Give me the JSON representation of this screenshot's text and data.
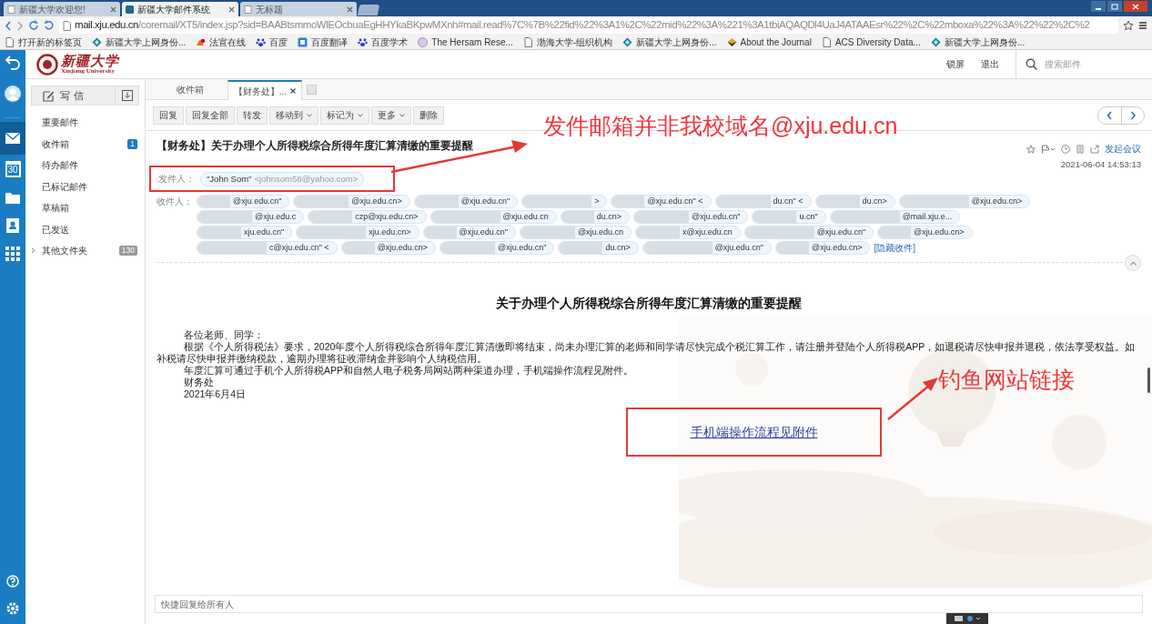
{
  "browser": {
    "tabs": [
      {
        "title": "新疆大学欢迎您!",
        "selected": false
      },
      {
        "title": "新疆大学邮件系统",
        "selected": true
      },
      {
        "title": "无标题",
        "selected": false
      }
    ],
    "url": "**mail.xju.edu.cn**/coremail/XT5/index.jsp?sid=BAABtsmmoWlEOcbuaEgHHYkaBKpwMXnh#mail.read%7C%7B%22fid%22%3A1%2C%22mid%22%3A%221%3A1tbiAQAQDl4UaJ4ATAAEsr%22%2C%22mboxa%22%3A%22%22%2C%2",
    "bookmarks": [
      {
        "label": "打开新的标签页",
        "kind": "page"
      },
      {
        "label": "新疆大学上网身份...",
        "kind": "diamond"
      },
      {
        "label": "法宣在线",
        "kind": "law"
      },
      {
        "label": "百度",
        "kind": "paw"
      },
      {
        "label": "百度翻译",
        "kind": "translate"
      },
      {
        "label": "百度学术",
        "kind": "paw"
      },
      {
        "label": "The Hersam Rese...",
        "kind": "circle"
      },
      {
        "label": "渤海大学-组织机构",
        "kind": "page"
      },
      {
        "label": "新疆大学上网身份...",
        "kind": "diamond"
      },
      {
        "label": "About the Journal",
        "kind": "journal"
      },
      {
        "label": "ACS Diversity Data...",
        "kind": "page"
      },
      {
        "label": "新疆大学上网身份...",
        "kind": "diamond"
      }
    ]
  },
  "rail": {
    "calendar_day": "30"
  },
  "header": {
    "logo_name": "新疆大学",
    "logo_subtitle": "Xinjiang University",
    "links": [
      "锁屏",
      "退出"
    ],
    "search_placeholder": "搜索邮件"
  },
  "sidebar": {
    "compose": "写信",
    "folders": [
      {
        "label": "重要邮件",
        "expandable": false
      },
      {
        "label": "收件箱",
        "badge": "1",
        "color": "#1b7dc1",
        "expandable": false
      },
      {
        "label": "待办邮件",
        "expandable": false
      },
      {
        "label": "已标记邮件",
        "expandable": false
      },
      {
        "label": "草稿箱",
        "expandable": false
      },
      {
        "label": "已发送",
        "expandable": false
      },
      {
        "label": "其他文件夹",
        "badge": "130",
        "color": "#999999",
        "expandable": true
      }
    ]
  },
  "mail_tabs": [
    {
      "label": "收件箱",
      "selected": false,
      "closable": false
    },
    {
      "label": "【财务处】...",
      "selected": true,
      "closable": true
    }
  ],
  "toolbar": [
    {
      "label": "回复",
      "dropdown": false
    },
    {
      "label": "回复全部",
      "dropdown": false
    },
    {
      "label": "转发",
      "dropdown": false
    },
    {
      "label": "移动到",
      "dropdown": true
    },
    {
      "label": "标记为",
      "dropdown": true
    },
    {
      "label": "更多",
      "dropdown": true
    },
    {
      "label": "删除",
      "dropdown": false
    }
  ],
  "message": {
    "subject": "【财务处】关于办理个人所得税综合所得年度汇算清缴的重要提醒",
    "meeting_link": "发起会议",
    "date": "2021-06-04 14:53:13",
    "sender_label": "发件人：",
    "sender_name": "\"John Som\"",
    "sender_address": "<johnsom58@yahoo.com>",
    "recipients_label": "收件人：",
    "recipients": [
      [
        "@xju.edu.cn\"",
        "@xju.edu.cn>",
        "@xju.edu.cn\"",
        ">",
        "@xju.edu.cn\" <",
        "du.cn\" <",
        "du.cn>",
        "@xju.edu.cn>"
      ],
      [
        "@xju.edu.c",
        "czp@xju.edu.cn>",
        "@xju.edu.cn",
        "du.cn>",
        "@xju.edu.cn\"",
        "u.cn\"",
        "@mail.xju.e..."
      ],
      [
        "xju.edu.cn\"",
        "xju.edu.cn>",
        "@xju.edu.cn\"",
        "@xju.edu.cn",
        "x@xju.edu.cn",
        "@xju.edu.cn\"",
        "@xju.edu.cn>"
      ],
      [
        "c@xju.edu.cn\" <",
        "@xju.edu.cn>",
        "@xju.edu.cn\"",
        "du.cn>",
        "@xju.edu.cn\"",
        "@xju.edu.cn>"
      ]
    ],
    "hide_link": "[隐藏收件]",
    "body_title": "关于办理个人所得税综合所得年度汇算清缴的重要提醒",
    "body": [
      "各位老师、同学：",
      "根据《个人所得税法》要求，2020年度个人所得税综合所得年度汇算清缴即将结束，尚未办理汇算的老师和同学请尽快完成个税汇算工作，请注册并登陆个人所得税APP，如退税请尽快申报并退税，依法享受权益。如补税请尽快申报并缴纳税款，逾期办理将征收滞纳金并影响个人纳税信用。",
      "年度汇算可通过手机个人所得税APP和自然人电子税务局网站两种渠道办理，手机端操作流程见附件。",
      "财务处",
      "2021年6月4日"
    ],
    "attachment_link": "手机端操作流程见附件",
    "quick_reply_placeholder": "快捷回复给所有人"
  },
  "annotations": [
    {
      "text": "发件邮箱并非我校域名@xju.edu.cn",
      "kind": "sender"
    },
    {
      "text": "钓鱼网站链接",
      "kind": "link"
    }
  ]
}
